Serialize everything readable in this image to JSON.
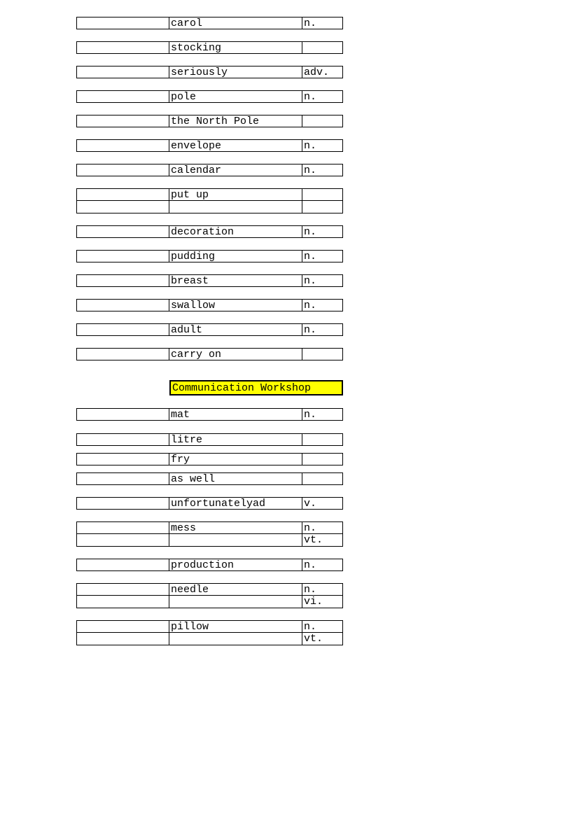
{
  "entries1": [
    {
      "rows": [
        {
          "c1": "",
          "c2": "carol",
          "c3": "n."
        }
      ]
    },
    {
      "rows": [
        {
          "c1": "",
          "c2": "stocking",
          "c3": ""
        }
      ]
    },
    {
      "rows": [
        {
          "c1": "",
          "c2": "seriously",
          "c3": "adv."
        }
      ]
    },
    {
      "rows": [
        {
          "c1": "",
          "c2": "pole",
          "c3": "n."
        }
      ]
    },
    {
      "rows": [
        {
          "c1": "",
          "c2": "the  North Pole",
          "c3": ""
        }
      ]
    },
    {
      "rows": [
        {
          "c1": "",
          "c2": "envelope",
          "c3": "n."
        }
      ]
    },
    {
      "rows": [
        {
          "c1": "",
          "c2": "calendar",
          "c3": "n."
        }
      ]
    },
    {
      "rows": [
        {
          "c1": "",
          "c2": "put up",
          "c3": ""
        },
        {
          "c1": "",
          "c2": "",
          "c3": ""
        }
      ]
    },
    {
      "rows": [
        {
          "c1": "",
          "c2": "decoration",
          "c3": "n."
        }
      ]
    },
    {
      "rows": [
        {
          "c1": "",
          "c2": "pudding",
          "c3": "n."
        }
      ]
    },
    {
      "rows": [
        {
          "c1": "",
          "c2": "breast",
          "c3": "n."
        }
      ]
    },
    {
      "rows": [
        {
          "c1": "",
          "c2": "swallow",
          "c3": "n."
        }
      ]
    },
    {
      "rows": [
        {
          "c1": "",
          "c2": "adult",
          "c3": "n."
        }
      ]
    },
    {
      "rows": [
        {
          "c1": "",
          "c2": "carry on",
          "c3": ""
        }
      ]
    }
  ],
  "heading": "Communication Workshop",
  "entries2": [
    {
      "rows": [
        {
          "c1": "",
          "c2": "mat",
          "c3": "n."
        }
      ]
    },
    {
      "rows": [
        {
          "c1": "",
          "c2": "litre",
          "c3": ""
        }
      ]
    },
    {
      "rows": [
        {
          "c1": "",
          "c2": "fry",
          "c3": ""
        }
      ]
    },
    {
      "rows": [
        {
          "c1": "",
          "c2": "as well",
          "c3": ""
        }
      ]
    },
    {
      "rows": [
        {
          "c1": "",
          "c2": "unfortunatelyad",
          "c3": "v."
        }
      ]
    },
    {
      "rows": [
        {
          "c1": "",
          "c2": "mess",
          "c3": "n."
        },
        {
          "c1": "",
          "c2": "",
          "c3": "vt."
        }
      ]
    },
    {
      "rows": [
        {
          "c1": "",
          "c2": "production",
          "c3": "n."
        }
      ]
    },
    {
      "rows": [
        {
          "c1": "",
          "c2": "needle",
          "c3": "n."
        },
        {
          "c1": "",
          "c2": "",
          "c3": "vi."
        }
      ]
    },
    {
      "rows": [
        {
          "c1": "",
          "c2": "pillow",
          "c3": "n."
        },
        {
          "c1": "",
          "c2": "",
          "c3": "vt."
        }
      ]
    }
  ],
  "spacing2": [
    18,
    10,
    10,
    17,
    17,
    17,
    17,
    17,
    17
  ]
}
